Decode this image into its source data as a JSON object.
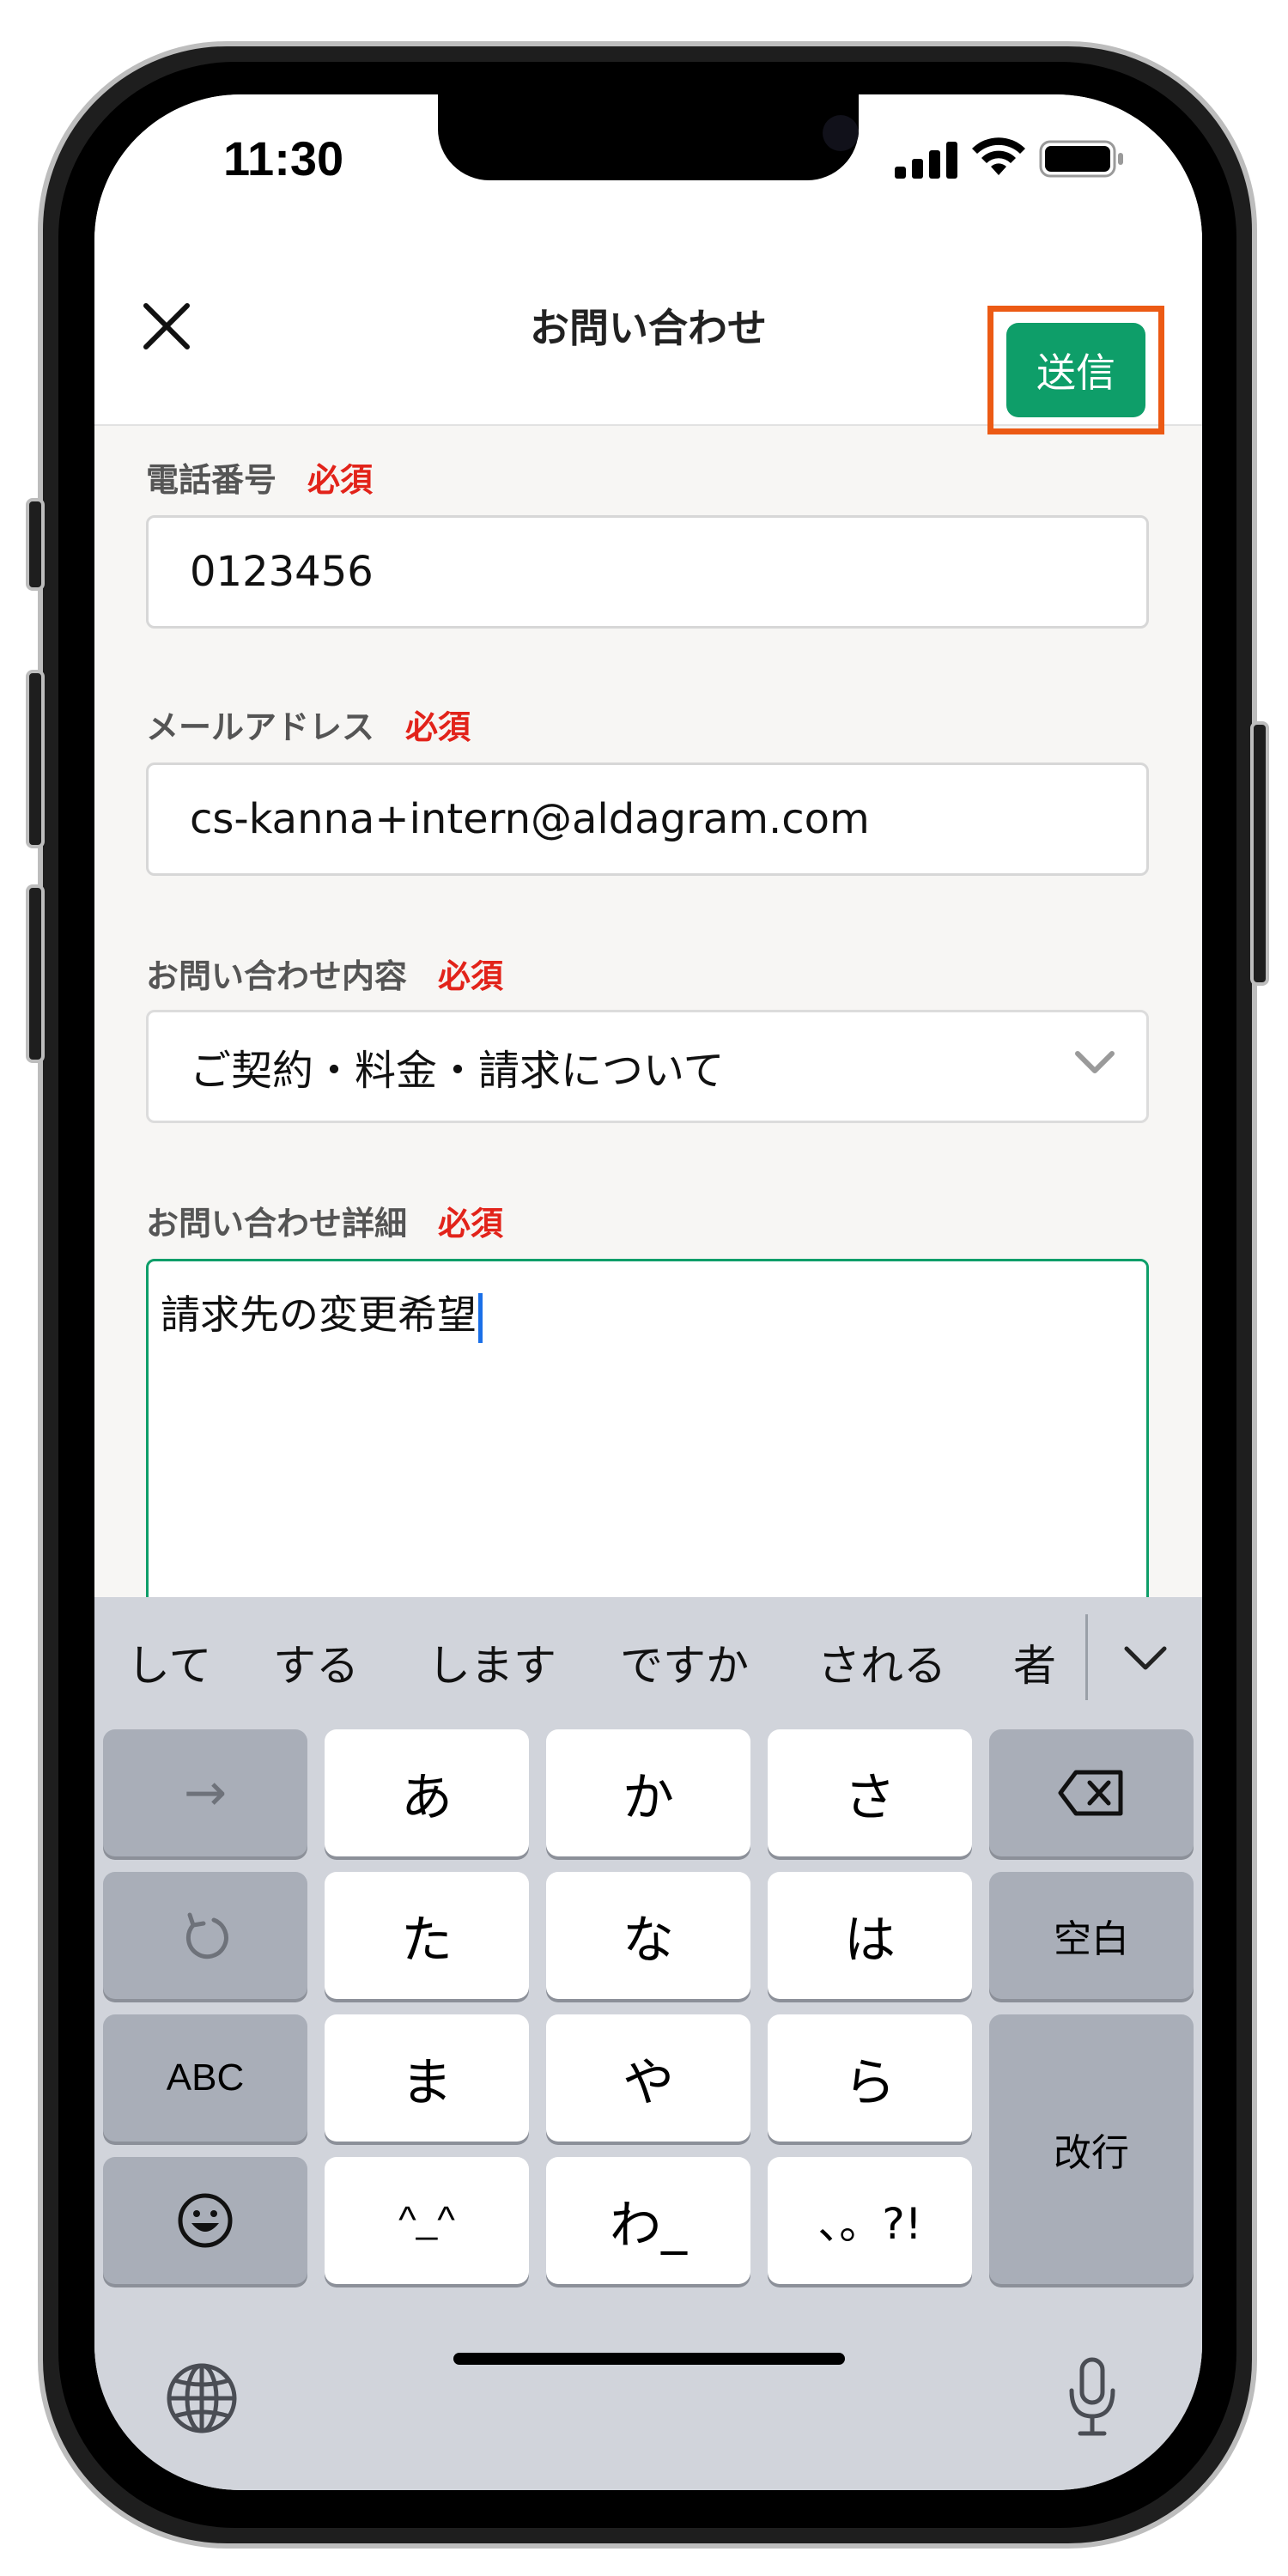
{
  "status_bar": {
    "time": "11:30"
  },
  "nav": {
    "title": "お問い合わせ",
    "send_label": "送信"
  },
  "form": {
    "phone": {
      "label": "電話番号",
      "required": "必須",
      "value": "0123456"
    },
    "email": {
      "label": "メールアドレス",
      "required": "必須",
      "value": "cs-kanna+intern@aldagram.com"
    },
    "category": {
      "label": "お問い合わせ内容",
      "required": "必須",
      "value": "ご契約・料金・請求について"
    },
    "detail": {
      "label": "お問い合わせ詳細",
      "required": "必須",
      "value": "請求先の変更希望"
    }
  },
  "keyboard": {
    "suggestions": [
      "して",
      "する",
      "します",
      "ですか",
      "される",
      "者"
    ],
    "keys": {
      "arrow": "→",
      "a": "あ",
      "ka": "か",
      "sa": "さ",
      "ta": "た",
      "na": "な",
      "ha": "は",
      "ma": "ま",
      "ya": "や",
      "ra": "ら",
      "kaomoji": "^_^",
      "wa": "わ_",
      "punct": "、。?!",
      "space": "空白",
      "abc": "ABC",
      "enter": "改行"
    }
  },
  "icons": {
    "close": "close-icon",
    "chevron": "chevron-down-icon",
    "delete": "delete-icon",
    "undo": "undo-icon",
    "emoji": "emoji-icon",
    "globe": "globe-icon",
    "mic": "microphone-icon"
  },
  "colors": {
    "accent": "#0e9e69",
    "highlight": "#ec5a14",
    "required": "#e2231a",
    "caret": "#1a6fe8"
  }
}
